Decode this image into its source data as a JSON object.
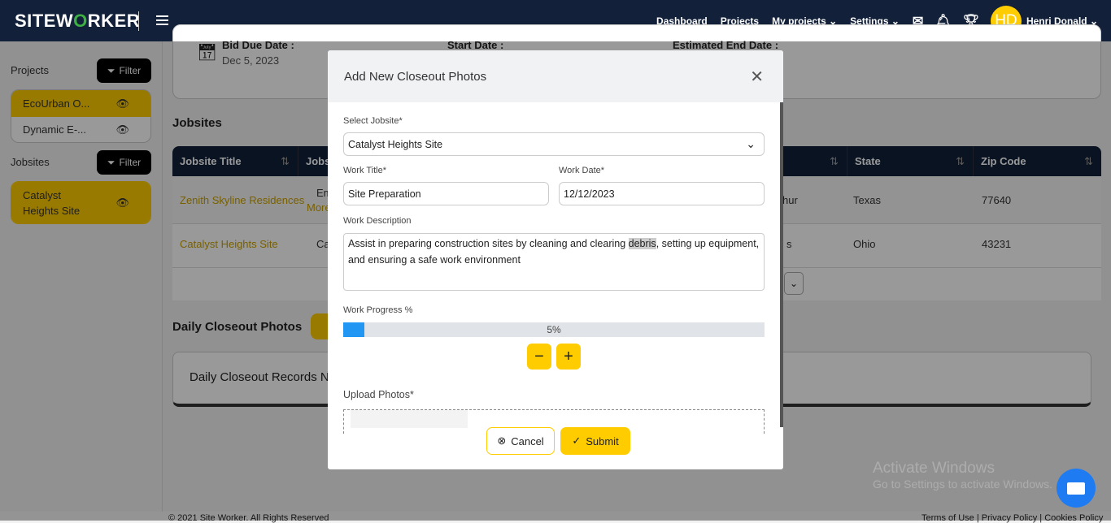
{
  "nav": {
    "logo": "SITEWORKER",
    "links": [
      "Dashboard",
      "Projects",
      "My projects",
      "Settings"
    ],
    "avatar": "HD",
    "user": "Henri Donald"
  },
  "sidebar": {
    "projects_label": "Projects",
    "filter": "Filter",
    "projects": [
      {
        "name": "EcoUrban O...",
        "selected": true
      },
      {
        "name": "Dynamic E-...",
        "selected": false
      }
    ],
    "jobsites_label": "Jobsites",
    "jobsites": [
      {
        "name": "Catalyst Heights Site",
        "selected": true
      }
    ]
  },
  "project": {
    "bid_due_label": "Bid Due Date :",
    "bid_due": "Dec 5, 2023",
    "start_label": "Start Date :",
    "end_label": "Estimated End Date :"
  },
  "jobsites": {
    "title": "Jobsites",
    "columns": [
      "Jobsite Title",
      "Jobs",
      "",
      "State",
      "Zip Code"
    ],
    "rows": [
      {
        "title": "Zenith Skyline Residences",
        "c2": "Em",
        "c2b": "More",
        "c3": "hur",
        "state": "Texas",
        "zip": "77640"
      },
      {
        "title": "Catalyst Heights Site",
        "c2": "Ca",
        "c2b": "",
        "c3": "s",
        "state": "Ohio",
        "zip": "43231"
      }
    ]
  },
  "closeout": {
    "title": "Daily Closeout Photos",
    "records": "Daily Closeout Records N"
  },
  "footer": {
    "copyright": "© 2021 Site Worker. All Rights Reserved",
    "links": "Terms of Use | Privacy Policy | Cookies Policy"
  },
  "watermark": {
    "title": "Activate Windows",
    "sub": "Go to Settings to activate Windows."
  },
  "modal": {
    "title": "Add New Closeout Photos",
    "jobsite_label": "Select Jobsite*",
    "jobsite": "Catalyst Heights Site",
    "work_title_label": "Work Title*",
    "work_title": "Site Preparation",
    "work_date_label": "Work Date*",
    "work_date": "12/12/2023",
    "desc_label": "Work Description",
    "desc_pre": "Assist in preparing construction sites by cleaning and clearing ",
    "desc_mark": "debris",
    "desc_post": ", setting up equipment, and ensuring a safe work environment",
    "progress_label": "Work Progress %",
    "progress": 5,
    "progress_text": "5%",
    "upload_label": "Upload Photos*",
    "cancel": "Cancel",
    "submit": "Submit"
  },
  "colors": {
    "accent": "#ffcc00",
    "nav": "#12203a",
    "progress": "#2196f3"
  }
}
